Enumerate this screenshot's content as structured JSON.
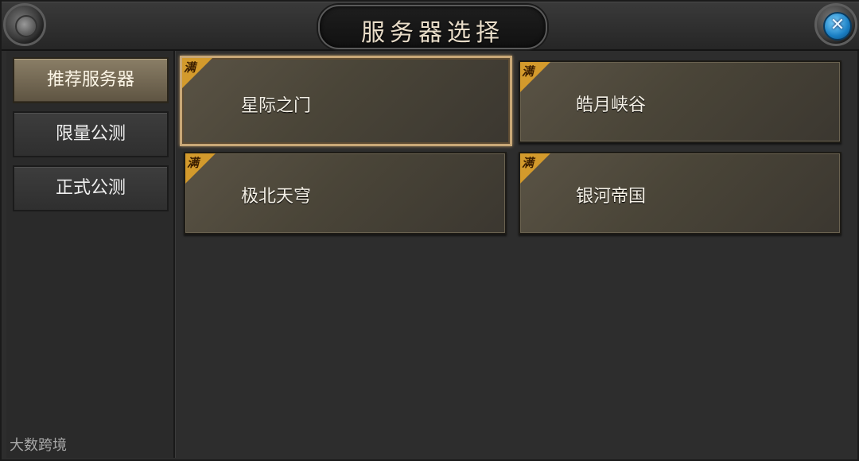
{
  "window": {
    "title": "服务器选择"
  },
  "sidebar": {
    "tabs": [
      {
        "label": "推荐服务器",
        "active": true
      },
      {
        "label": "限量公测",
        "active": false
      },
      {
        "label": "正式公测",
        "active": false
      }
    ]
  },
  "servers": [
    {
      "name": "星际之门",
      "badge": "满",
      "selected": true
    },
    {
      "name": "皓月峡谷",
      "badge": "满",
      "selected": false
    },
    {
      "name": "极北天穹",
      "badge": "满",
      "selected": false
    },
    {
      "name": "银河帝国",
      "badge": "满",
      "selected": false
    }
  ],
  "icons": {
    "close": "close-icon",
    "ornament": "orb-ornament-icon"
  },
  "colors": {
    "badge": "#d39a2c",
    "active_tab": "#8a7e66",
    "selected_border": "#c9a877",
    "close_button": "#1a7fc4"
  },
  "watermark": "大数跨境"
}
